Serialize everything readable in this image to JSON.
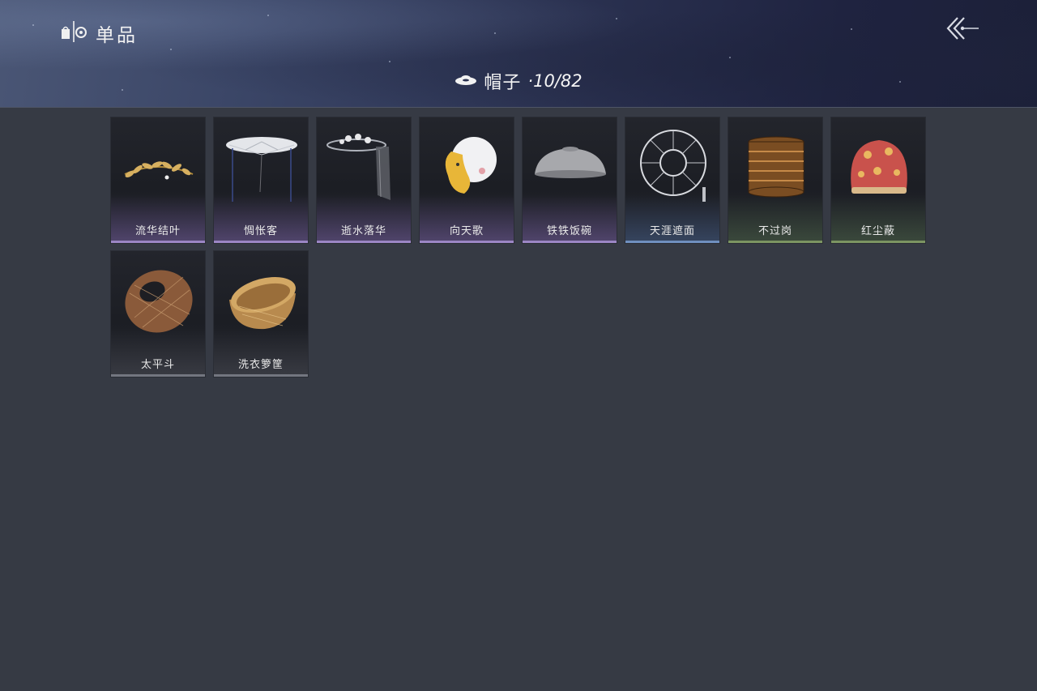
{
  "header": {
    "title": "单品",
    "icon": "wardrobe-icon",
    "back_icon": "back-arrow-icon"
  },
  "category": {
    "icon": "hat-icon",
    "label": "帽子",
    "count": "·10/82"
  },
  "items": [
    {
      "name": "流华结叶",
      "rarity": "purple",
      "icon": "golden-leaf-crown"
    },
    {
      "name": "惆怅客",
      "rarity": "purple",
      "icon": "veiled-hat"
    },
    {
      "name": "逝水落华",
      "rarity": "purple",
      "icon": "flower-hat-with-veil"
    },
    {
      "name": "向天歌",
      "rarity": "purple",
      "icon": "goose-hat"
    },
    {
      "name": "铁铁饭碗",
      "rarity": "purple",
      "icon": "iron-bowl-hat"
    },
    {
      "name": "天涯遮面",
      "rarity": "blue",
      "icon": "wire-frame-hat"
    },
    {
      "name": "不过岗",
      "rarity": "green",
      "icon": "stacked-bowls-hat"
    },
    {
      "name": "红尘蔽",
      "rarity": "green",
      "icon": "red-cloth-cap"
    },
    {
      "name": "太平斗",
      "rarity": "grey",
      "icon": "woven-ring-hat"
    },
    {
      "name": "洗衣箩筐",
      "rarity": "grey",
      "icon": "wicker-basket-hat"
    }
  ],
  "colors": {
    "background": "#363a44",
    "purple_rim": "#9b86c4",
    "blue_rim": "#6f8fbf",
    "green_rim": "#7c9462",
    "grey_rim": "#737680"
  }
}
